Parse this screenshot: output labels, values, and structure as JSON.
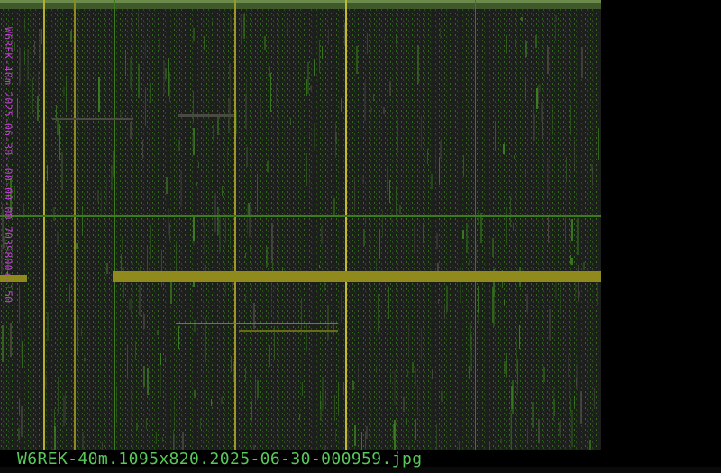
{
  "window": {
    "vertical_caption": "W6REK-40m 2025-06-30--00-00-00 7039800+-150",
    "filename": "W6REK-40m.1095x820.2025-06-30-000959.jpg"
  },
  "colors": {
    "background": "#000000",
    "waterfall_base": "#1d1f1c",
    "noise_green": "#3f8a22",
    "signal_yellow": "#9a9a1a",
    "grid_yellow": "#b5b02a",
    "grid_green": "#3d7a1d",
    "caption_magenta": "#c23bd6",
    "filename_green": "#57c85a"
  }
}
